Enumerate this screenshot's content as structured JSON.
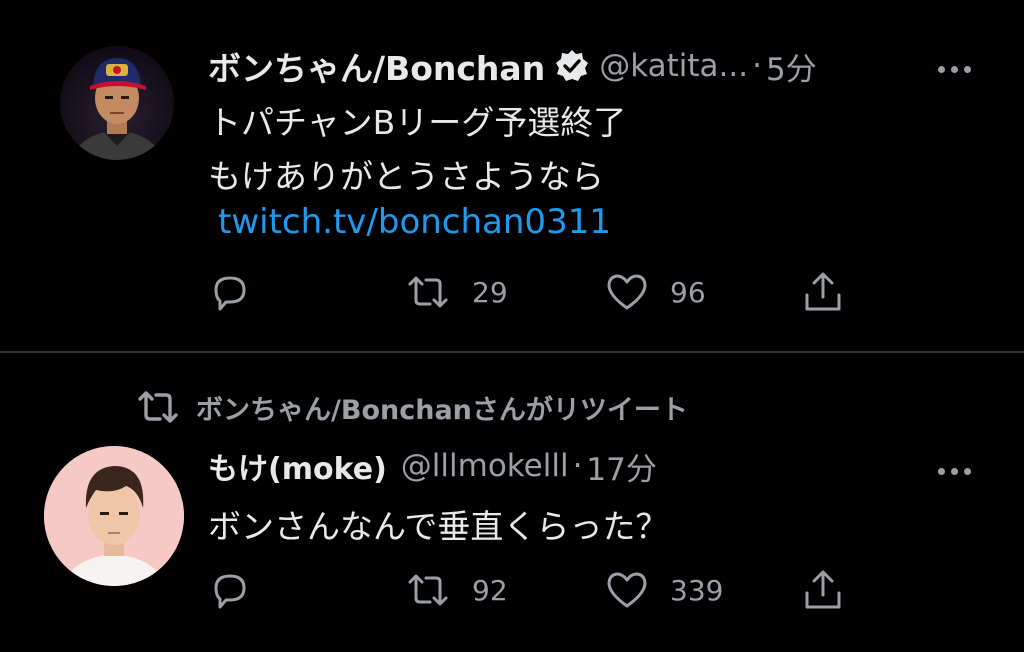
{
  "tweets": [
    {
      "display_name": "ボンちゃん/Bonchan",
      "handle": "@katita...",
      "separator": "·",
      "time": "5分",
      "lines": [
        "トパチャンBリーグ予選終了",
        "もけありがとうさようなら"
      ],
      "link": "twitch.tv/bonchan0311",
      "retweets": "29",
      "likes": "96"
    },
    {
      "retweeted_by": "ボンちゃん/Bonchanさんがリツイート",
      "display_name": "もけ(moke)",
      "handle": "@lllmokelll",
      "separator": "·",
      "time": "17分",
      "lines": [
        "ボンさんなんで垂直くらった？"
      ],
      "retweets": "92",
      "likes": "339"
    }
  ],
  "icons": {
    "verified": "verified-badge-icon",
    "more": "more-dots-icon",
    "reply": "reply-icon",
    "retweet": "retweet-icon",
    "like": "heart-icon",
    "share": "share-icon"
  },
  "colors": {
    "background": "#000000",
    "text": "#e7e9ea",
    "secondary": "#9aa0a6",
    "link": "#1d9bf0",
    "divider": "#2f3336"
  }
}
